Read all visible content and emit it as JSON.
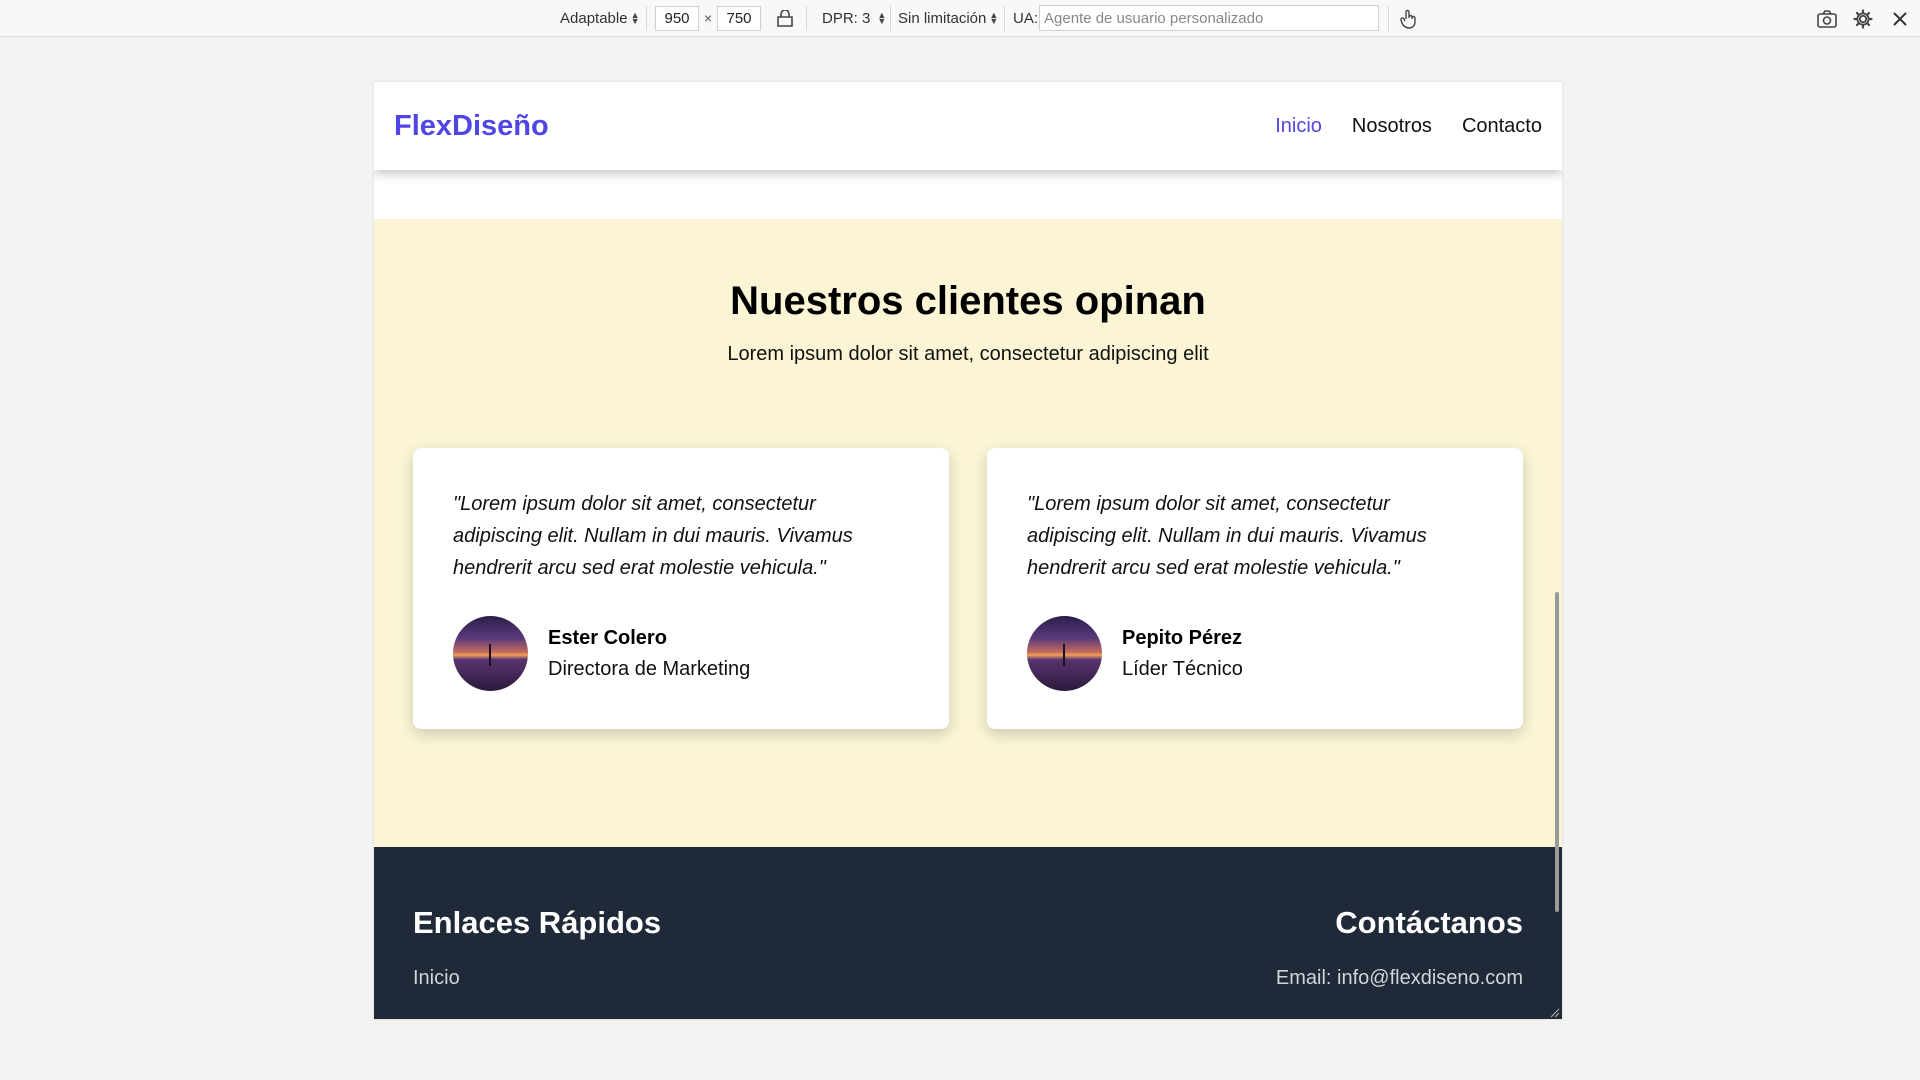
{
  "toolbar": {
    "device_mode": "Adaptable",
    "width": "950",
    "height": "750",
    "times": "×",
    "dpr": "DPR: 3",
    "throttle": "Sin limitación",
    "ua_label": "UA:",
    "ua_placeholder": "Agente de usuario personalizado",
    "icons": [
      "rotate-icon",
      "touch-icon",
      "screenshot-icon",
      "settings-icon",
      "close-icon"
    ]
  },
  "site": {
    "logo": "FlexDiseño",
    "nav": [
      {
        "label": "Inicio",
        "active": true
      },
      {
        "label": "Nosotros",
        "active": false
      },
      {
        "label": "Contacto",
        "active": false
      }
    ],
    "accent_color": "#4f46e5",
    "section_bg": "#fbf5d6",
    "footer_bg": "#1f2937"
  },
  "testimonials": {
    "title": "Nuestros clientes opinan",
    "subtitle": "Lorem ipsum dolor sit amet, consectetur adipiscing elit",
    "items": [
      {
        "quote": "\"Lorem ipsum dolor sit amet, consectetur adipiscing elit. Nullam in dui mauris. Vivamus hendrerit arcu sed erat molestie vehicula.\"",
        "name": "Ester Colero",
        "role": "Directora de Marketing"
      },
      {
        "quote": "\"Lorem ipsum dolor sit amet, consectetur adipiscing elit. Nullam in dui mauris. Vivamus hendrerit arcu sed erat molestie vehicula.\"",
        "name": "Pepito Pérez",
        "role": "Líder Técnico"
      }
    ]
  },
  "footer": {
    "links_title": "Enlaces Rápidos",
    "first_link": "Inicio",
    "contact_title": "Contáctanos",
    "email": "Email: info@flexdiseno.com"
  }
}
